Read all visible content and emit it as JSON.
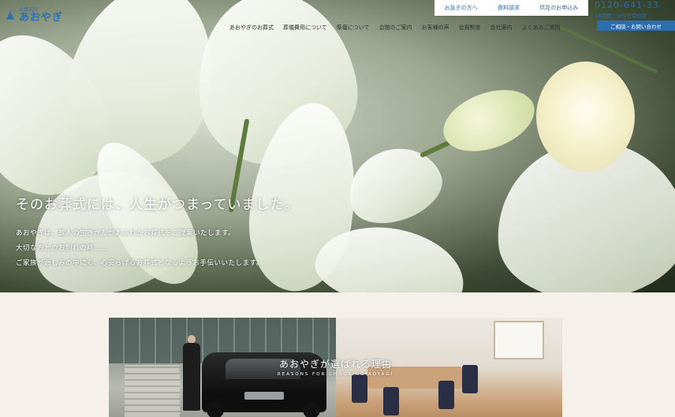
{
  "logo": {
    "small": "お葬式の",
    "big": "あおやぎ"
  },
  "utility": {
    "urgent": "お急ぎの方へ",
    "brochure": "資料請求",
    "flowers": "供花のお申込み"
  },
  "contact": {
    "phone": "0120-641-33",
    "hours": "24時間・365日受付対",
    "consult": "ご相談・お問い合わせ"
  },
  "nav": [
    "あおやぎのお葬式",
    "葬儀費用について",
    "祭壇について",
    "会館のご案内",
    "お客様の声",
    "会員制度",
    "会社案内",
    "よくあるご質問"
  ],
  "hero": {
    "headline": "そのお葬式には、人生がつまっていました。",
    "lines": [
      "あおやぎは、故人の生きかたがあふれたお葬式をご提案いたします。",
      "大切な方とのお別れの時……",
      "ご家族が悲しみの中にも、心安らげるお葬式となるようお手伝いいたします。"
    ]
  },
  "reasons": {
    "title": "あおやぎが選ばれる理由",
    "subtitle": "REASONS FOR CHOOSING AOYAGI"
  }
}
